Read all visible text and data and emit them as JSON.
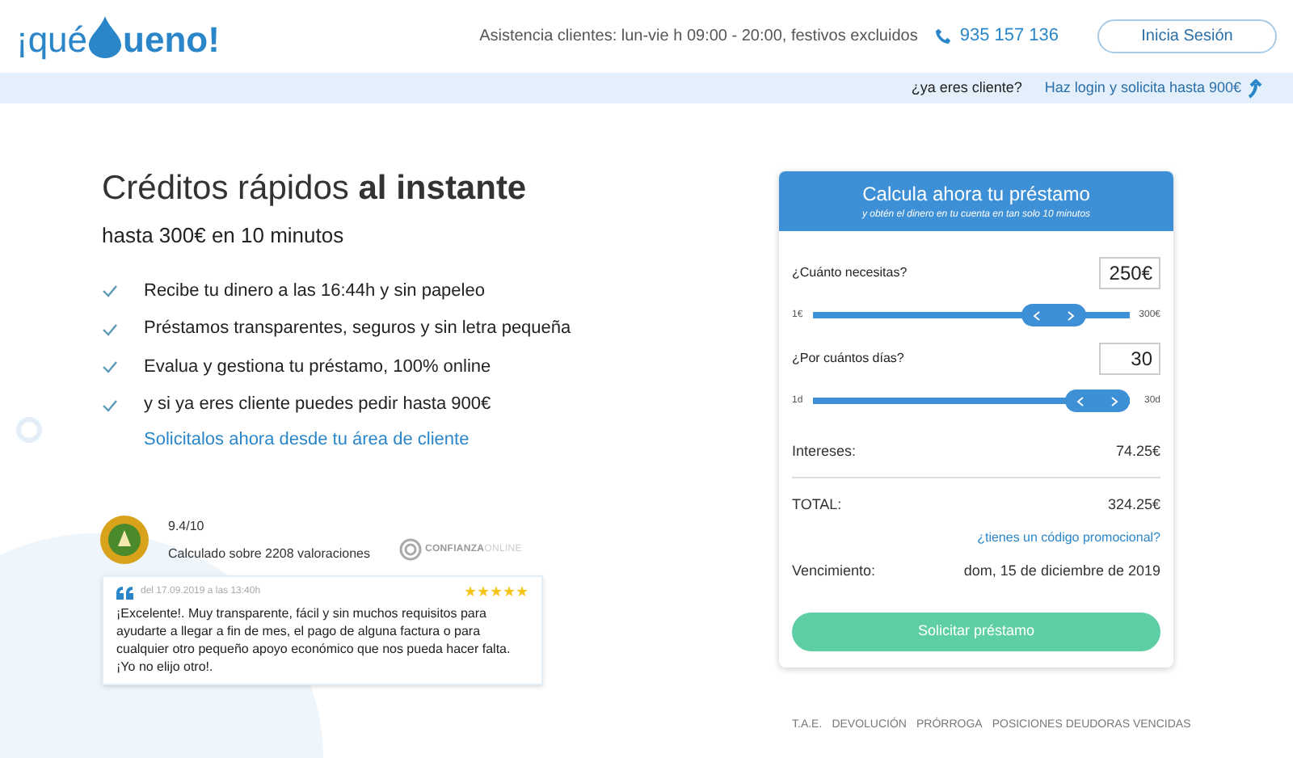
{
  "header": {
    "logo_left": "¡qué",
    "logo_right": "ueno!",
    "support": "Asistencia clientes: lun-vie h 09:00 - 20:00, festivos excluidos",
    "phone": "935 157 136",
    "login_button": "Inicia Sesión"
  },
  "client_bar": {
    "question": "¿ya eres cliente?",
    "link": "Haz login y solicita hasta 900€"
  },
  "hero": {
    "title_light": "Créditos rápidos",
    "title_bold": "al instante",
    "subtitle": "hasta 300€ en 10 minutos",
    "benefits": [
      "Recibe tu dinero a las 16:44h y sin papeleo",
      "Préstamos transparentes, seguros y sin letra pequeña",
      "Evalua y gestiona tu préstamo, 100% online",
      "y si ya eres cliente puedes pedir hasta 900€"
    ],
    "link": "Solicitalos ahora desde tu área de cliente"
  },
  "rating": {
    "score": "9.4/10",
    "caption": "Calculado sobre 2208 valoraciones",
    "trust_left": "CONFIANZA",
    "trust_right": "ONLINE"
  },
  "review": {
    "date": "del 17.09.2019 a las 13:40h",
    "stars": 5,
    "text": "¡Excelente!. Muy transparente, fácil y sin muchos requisitos para ayudarte a llegar a fin de mes, el pago de alguna factura o para cualquier otro pequeño apoyo económico que nos pueda hacer falta. ¡Yo no elijo otro!."
  },
  "calculator": {
    "title": "Calcula ahora tu préstamo",
    "subtitle": "y obtén el dinero en tu cuenta en tan solo 10 minutos",
    "sliders": [
      {
        "label": "¿Cuánto necesitas?",
        "value": "250€",
        "min": "1€",
        "max": "300€",
        "level": 0.83
      },
      {
        "label": "¿Por cuántos días?",
        "value": "30",
        "min": "1d",
        "max": "30d",
        "level": 1
      }
    ],
    "interest_label": "Intereses:",
    "interest": "74.25€",
    "total_label": "TOTAL:",
    "total": "324.25€",
    "promo_link": "¿tienes un código promocional?",
    "due_label": "Vencimiento:",
    "due": "dom, 15 de diciembre de 2019",
    "submit": "Solicitar préstamo"
  },
  "footer_links": [
    "T.A.E.",
    "DEVOLUCIÓN",
    "PRÓRROGA",
    "POSICIONES DEUDORAS VENCIDAS"
  ]
}
